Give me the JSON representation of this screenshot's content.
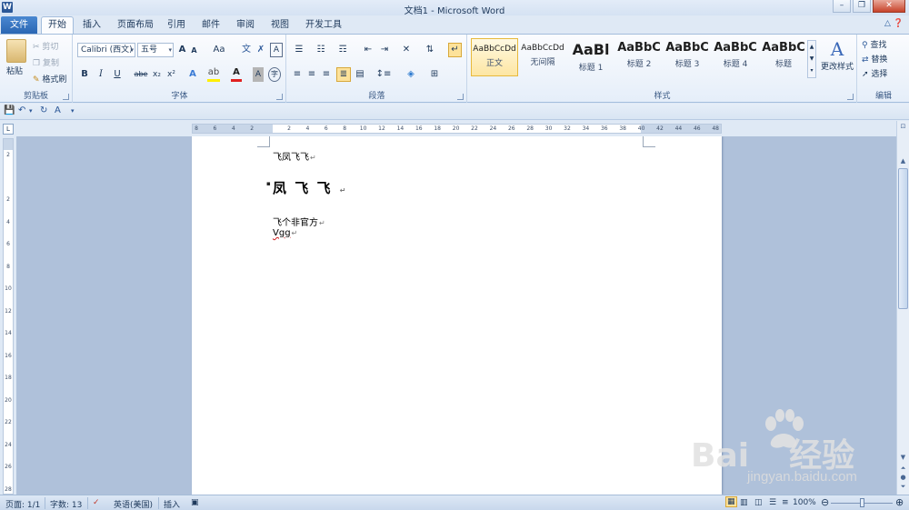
{
  "window": {
    "title": "文档1 - Microsoft Word",
    "app_icon_letter": "W"
  },
  "tabs": {
    "file": "文件",
    "items": [
      "开始",
      "插入",
      "页面布局",
      "引用",
      "邮件",
      "审阅",
      "视图",
      "开发工具"
    ],
    "active_index": 0
  },
  "ribbon": {
    "clipboard": {
      "label": "剪贴板",
      "paste": "粘贴",
      "cut": "剪切",
      "copy": "复制",
      "format_painter": "格式刷"
    },
    "font": {
      "label": "字体",
      "font_name": "Calibri (西文)",
      "font_size": "五号",
      "grow": "A",
      "shrink": "A",
      "change_case": "Aa",
      "bold": "B",
      "italic": "I",
      "underline": "U",
      "strike": "abe",
      "subscript": "x₂",
      "superscript": "x²"
    },
    "paragraph": {
      "label": "段落"
    },
    "styles": {
      "label": "样式",
      "items": [
        {
          "sample": "AaBbCcDd",
          "name": "正文"
        },
        {
          "sample": "AaBbCcDd",
          "name": "无间隔"
        },
        {
          "sample": "AaBl",
          "name": "标题 1"
        },
        {
          "sample": "AaBbC",
          "name": "标题 2"
        },
        {
          "sample": "AaBbC",
          "name": "标题 3"
        },
        {
          "sample": "AaBbC",
          "name": "标题 4"
        },
        {
          "sample": "AaBbC",
          "name": "标题"
        }
      ],
      "selected_index": 0,
      "change_styles": "更改样式"
    },
    "editing": {
      "label": "编辑",
      "find": "查找",
      "replace": "替换",
      "select": "选择"
    }
  },
  "ruler": {
    "ticks": [
      "8",
      "6",
      "4",
      "2",
      "",
      "2",
      "4",
      "6",
      "8",
      "10",
      "12",
      "14",
      "16",
      "18",
      "20",
      "22",
      "24",
      "26",
      "28",
      "30",
      "32",
      "34",
      "36",
      "38",
      "40",
      "42",
      "44",
      "46",
      "48"
    ],
    "vticks": [
      "2",
      "",
      "2",
      "4",
      "6",
      "8",
      "10",
      "12",
      "14",
      "16",
      "18",
      "20",
      "22",
      "24",
      "26",
      "28"
    ]
  },
  "document": {
    "lines": [
      {
        "text": "飞凤飞飞",
        "style": "normal"
      },
      {
        "text": "凤 飞 飞 ",
        "style": "heading"
      },
      {
        "text": "飞个非官方",
        "style": "normal"
      },
      {
        "text": "Vgg",
        "style": "normal"
      }
    ],
    "paragraph_mark": "↵"
  },
  "status": {
    "page": "页面: 1/1",
    "words": "字数: 13",
    "language": "英语(美国)",
    "mode": "插入",
    "zoom": "100%"
  },
  "watermark": {
    "brand": "Bai",
    "brand2": "经验",
    "url": "jingyan.baidu.com"
  }
}
